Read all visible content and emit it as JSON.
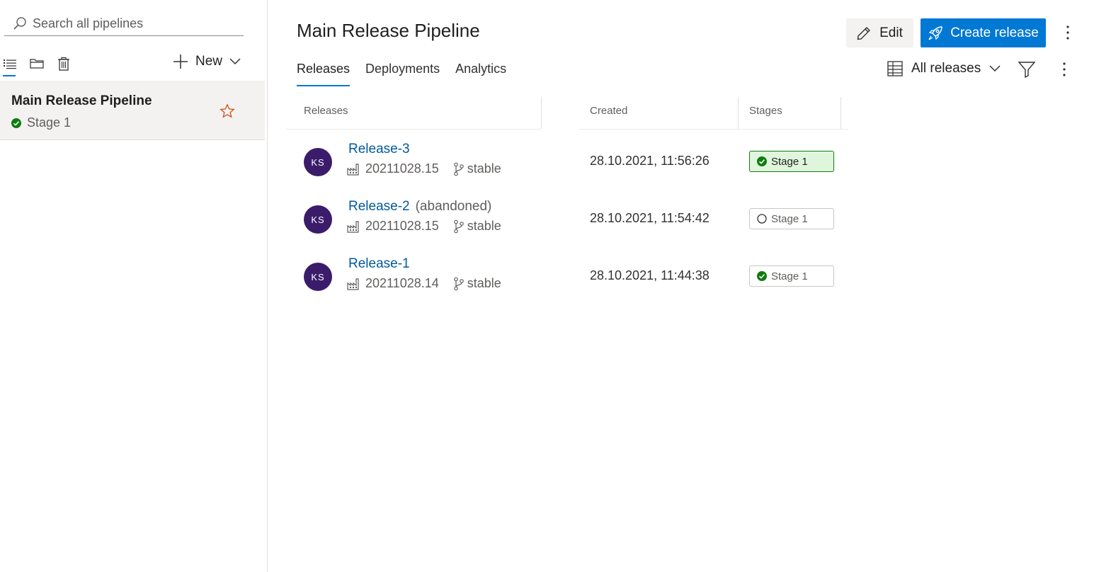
{
  "sidebar": {
    "search_placeholder": "Search all pipelines",
    "new_label": "New",
    "pipeline": {
      "title": "Main Release Pipeline",
      "stage": "Stage 1",
      "stage_status": "succeeded"
    }
  },
  "header": {
    "title": "Main Release Pipeline",
    "edit_label": "Edit",
    "create_label": "Create release"
  },
  "tabs": [
    {
      "label": "Releases",
      "active": true
    },
    {
      "label": "Deployments",
      "active": false
    },
    {
      "label": "Analytics",
      "active": false
    }
  ],
  "view_select": "All releases",
  "table": {
    "columns": [
      "Releases",
      "Created",
      "Stages"
    ],
    "rows": [
      {
        "avatar": "KS",
        "name": "Release-3",
        "suffix": "",
        "build": "20211028.15",
        "branch": "stable",
        "created": "28.10.2021, 11:56:26",
        "stage": "Stage 1",
        "stage_status": "succeeded-latest"
      },
      {
        "avatar": "KS",
        "name": "Release-2",
        "suffix": "(abandoned)",
        "build": "20211028.15",
        "branch": "stable",
        "created": "28.10.2021, 11:54:42",
        "stage": "Stage 1",
        "stage_status": "not-deployed"
      },
      {
        "avatar": "KS",
        "name": "Release-1",
        "suffix": "",
        "build": "20211028.14",
        "branch": "stable",
        "created": "28.10.2021, 11:44:38",
        "stage": "Stage 1",
        "stage_status": "succeeded"
      }
    ]
  },
  "colors": {
    "accent": "#0078d4",
    "link": "#005a9e",
    "success": "#107c10",
    "avatar_bg": "#3b1c6b",
    "star": "#ca5010"
  }
}
